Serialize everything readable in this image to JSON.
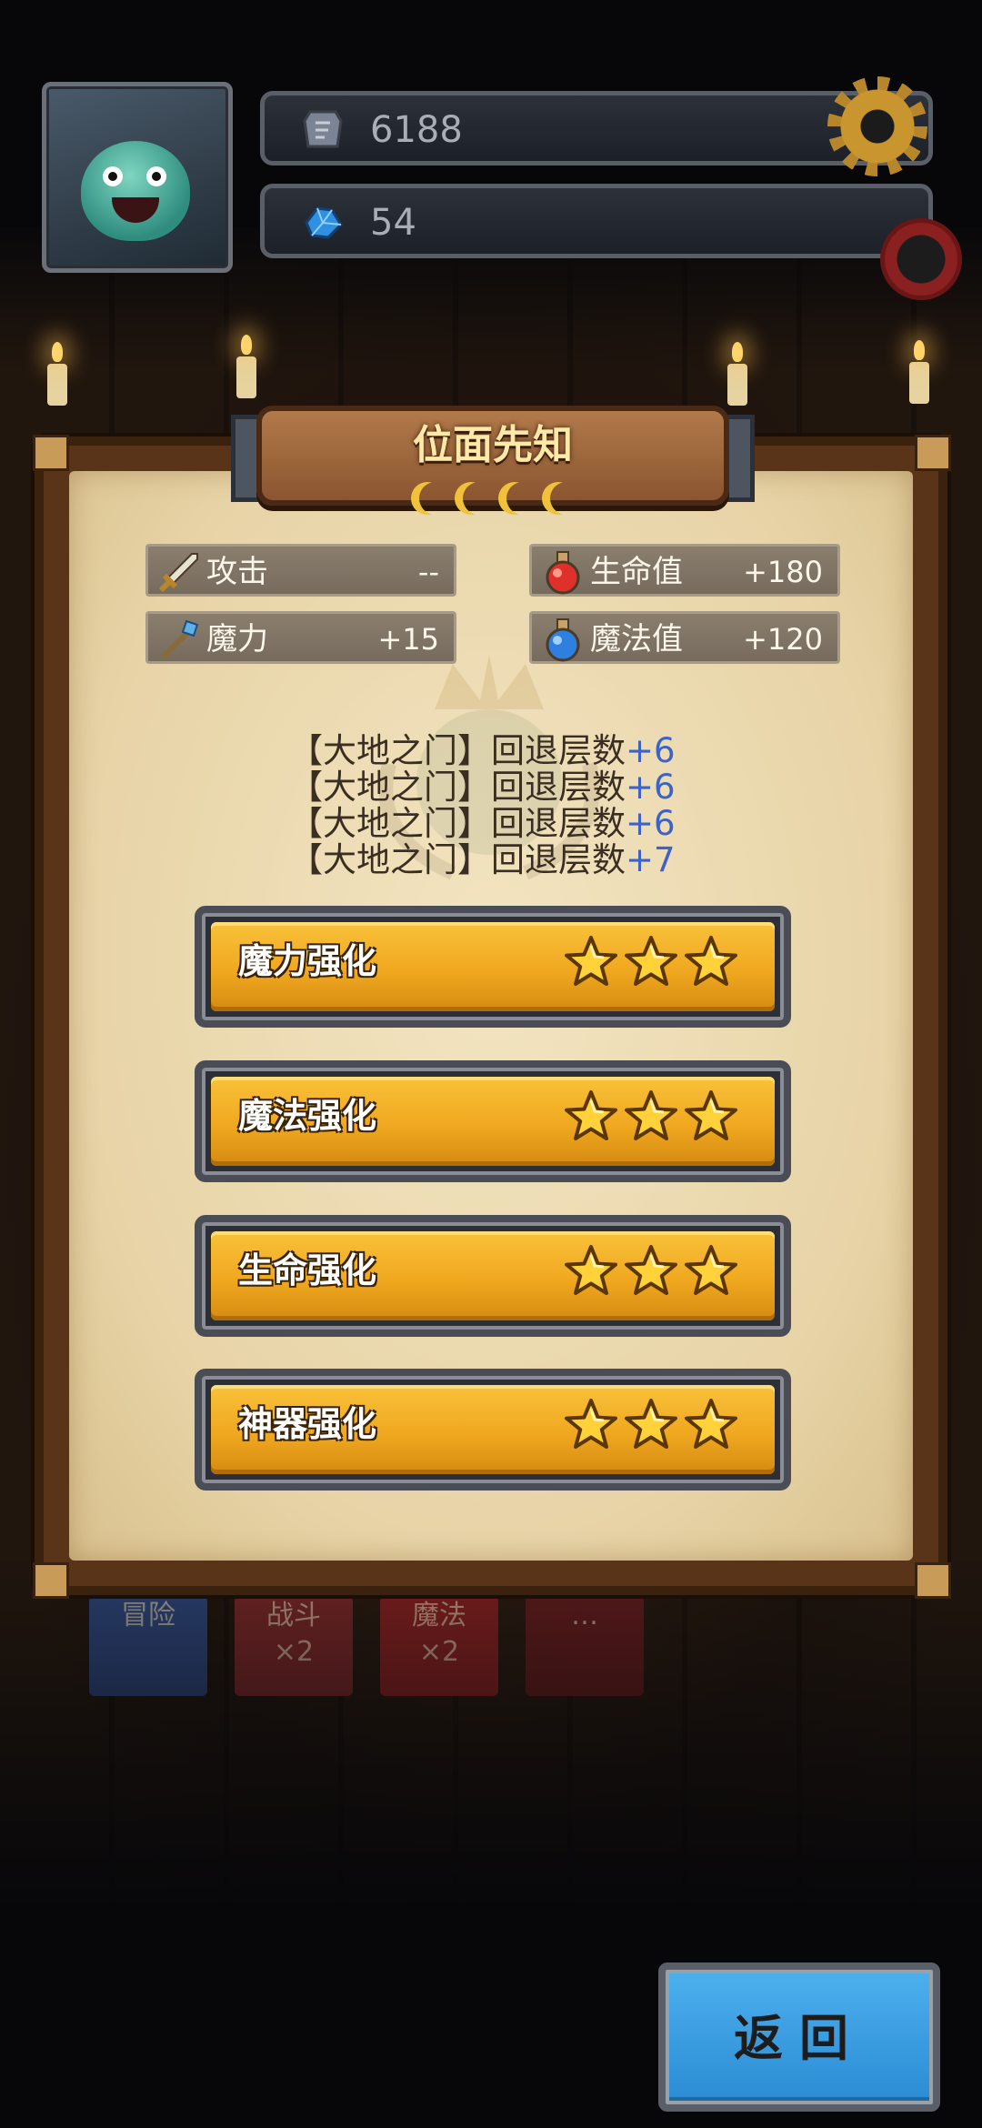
{
  "resources": {
    "gold": {
      "icon": "stone-tablet-icon",
      "value": "6188"
    },
    "gems": {
      "icon": "blue-crystal-icon",
      "value": "54"
    }
  },
  "panel": {
    "title": "位面先知",
    "moons_count": 4,
    "stats": [
      {
        "icon": "sword-icon",
        "label": "攻击",
        "value": "--"
      },
      {
        "icon": "red-potion-icon",
        "label": "生命值",
        "value": "+180"
      },
      {
        "icon": "magic-staff-icon",
        "label": "魔力",
        "value": "+15"
      },
      {
        "icon": "blue-potion-icon",
        "label": "魔法值",
        "value": "+120"
      }
    ],
    "bonuses": [
      {
        "text": "【大地之门】回退层数",
        "value": "+6"
      },
      {
        "text": "【大地之门】回退层数",
        "value": "+6"
      },
      {
        "text": "【大地之门】回退层数",
        "value": "+6"
      },
      {
        "text": "【大地之门】回退层数",
        "value": "+7"
      }
    ],
    "upgrades": [
      {
        "label": "魔力强化",
        "stars": 3
      },
      {
        "label": "魔法强化",
        "stars": 3
      },
      {
        "label": "生命强化",
        "stars": 3
      },
      {
        "label": "神器强化",
        "stars": 3
      }
    ]
  },
  "background_tabs": [
    {
      "label": "冒险",
      "sub": ""
    },
    {
      "label": "战斗",
      "sub": "×2"
    },
    {
      "label": "魔法",
      "sub": "×2"
    },
    {
      "label": "…",
      "sub": ""
    }
  ],
  "back_button": {
    "label": "返回"
  },
  "colors": {
    "panel_paper": "#efe0b9",
    "button_gold": "#f0a820",
    "bonus_value_blue": "#3d63c9",
    "back_button_blue": "#3a9ee2"
  }
}
